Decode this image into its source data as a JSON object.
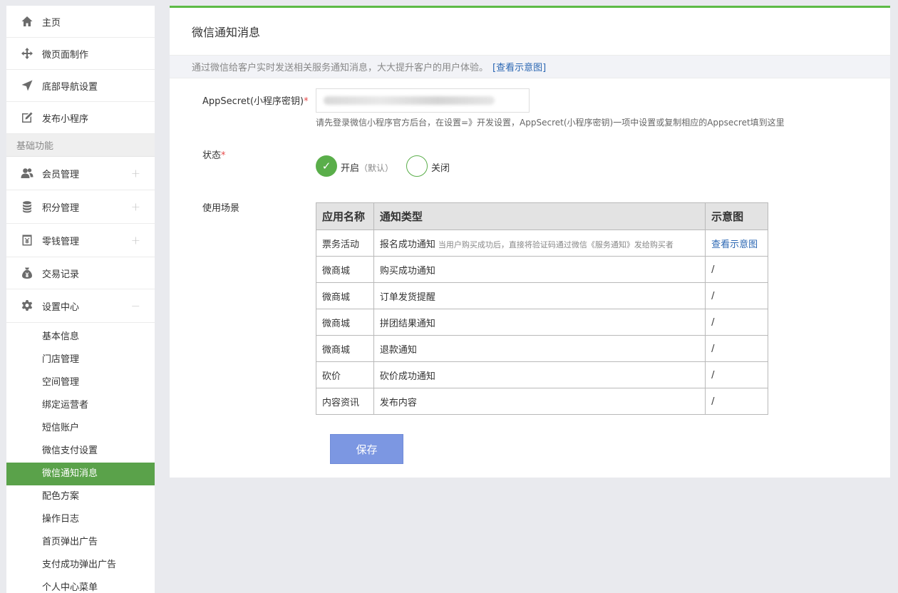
{
  "sidebar": {
    "top_items": [
      {
        "label": "主页",
        "icon": "home-icon"
      },
      {
        "label": "微页面制作",
        "icon": "move-icon"
      },
      {
        "label": "底部导航设置",
        "icon": "navigation-arrow-icon"
      },
      {
        "label": "发布小程序",
        "icon": "edit-icon"
      }
    ],
    "section_title": "基础功能",
    "feature_items": [
      {
        "label": "会员管理",
        "icon": "users-icon",
        "expand": "+"
      },
      {
        "label": "积分管理",
        "icon": "coins-icon",
        "expand": "+"
      },
      {
        "label": "零钱管理",
        "icon": "wallet-icon",
        "expand": "+"
      },
      {
        "label": "交易记录",
        "icon": "money-bag-icon",
        "expand": ""
      },
      {
        "label": "设置中心",
        "icon": "gear-icon",
        "expand": "−"
      }
    ],
    "sub_items": [
      "基本信息",
      "门店管理",
      "空间管理",
      "绑定运营者",
      "短信账户",
      "微信支付设置",
      "微信通知消息",
      "配色方案",
      "操作日志",
      "首页弹出广告",
      "支付成功弹出广告",
      "个人中心菜单"
    ],
    "active_sub": "微信通知消息"
  },
  "main": {
    "title": "微信通知消息",
    "info_text": "通过微信给客户实时发送相关服务通知消息，大大提升客户的用户体验。",
    "info_link": "[查看示意图]",
    "appsecret_label": "AppSecret(小程序密钥)",
    "required_mark": "*",
    "appsecret_hint": "请先登录微信小程序官方后台，在设置=》开发设置，AppSecret(小程序密钥)一项中设置或复制相应的Appsecret填到这里",
    "status_label": "状态",
    "status_on_label": "开启",
    "status_on_note": "（默认）",
    "status_off_label": "关闭",
    "status_selected": "开启",
    "scene_label": "使用场景",
    "table_headers": [
      "应用名称",
      "通知类型",
      "示意图"
    ],
    "table_rows": [
      {
        "app": "票务活动",
        "type": "报名成功通知",
        "desc": "当用户购买成功后，直接将验证码通过微信《服务通知》发给购买者",
        "preview": "查看示意图"
      },
      {
        "app": "微商城",
        "type": "购买成功通知",
        "desc": "",
        "preview": "/"
      },
      {
        "app": "微商城",
        "type": "订单发货提醒",
        "desc": "",
        "preview": "/"
      },
      {
        "app": "微商城",
        "type": "拼团结果通知",
        "desc": "",
        "preview": "/"
      },
      {
        "app": "微商城",
        "type": "退款通知",
        "desc": "",
        "preview": "/"
      },
      {
        "app": "砍价",
        "type": "砍价成功通知",
        "desc": "",
        "preview": "/"
      },
      {
        "app": "内容资讯",
        "type": "发布内容",
        "desc": "",
        "preview": "/"
      }
    ],
    "save_label": "保存"
  },
  "colors": {
    "accent_green": "#5aa24a",
    "link_blue": "#2b67b3",
    "save_button": "#7c97e2",
    "required_red": "#e64a4a"
  }
}
